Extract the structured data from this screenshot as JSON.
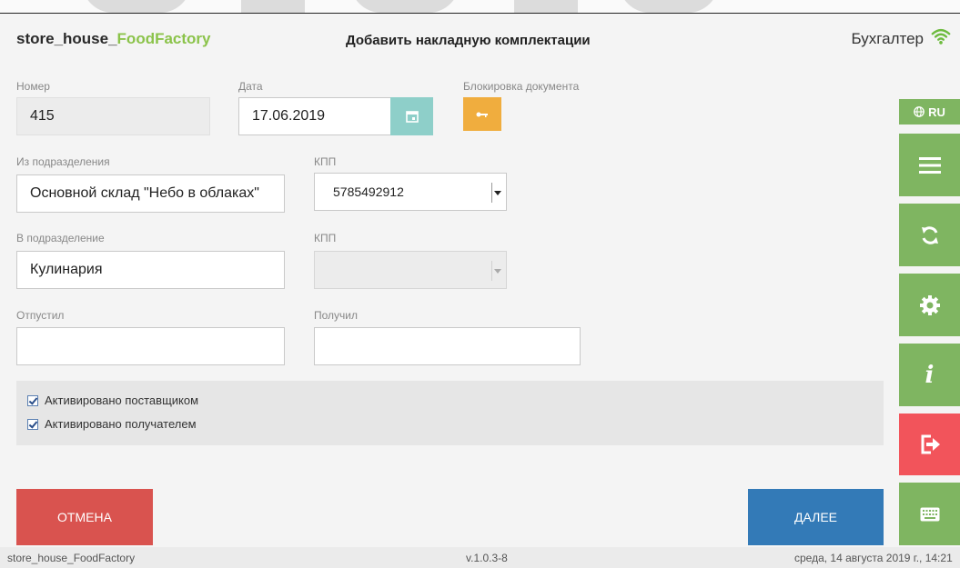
{
  "header": {
    "brand_main": "store_house_",
    "brand_accent": "FoodFactory",
    "title": "Добавить накладную комплектации",
    "user": "Бухгалтер"
  },
  "form": {
    "number_label": "Номер",
    "number_value": "415",
    "date_label": "Дата",
    "date_value": "17.06.2019",
    "lock_label": "Блокировка документа",
    "from_dept_label": "Из подразделения",
    "from_dept_value": "Основной склад \"Небо в облаках\"",
    "kpp1_label": "КПП",
    "kpp1_value": "5785492912",
    "to_dept_label": "В подразделение",
    "to_dept_value": "Кулинария",
    "kpp2_label": "КПП",
    "kpp2_value": "",
    "released_label": "Отпустил",
    "released_value": "",
    "received_label": "Получил",
    "received_value": ""
  },
  "checks": {
    "supplier_label": "Активировано поставщиком",
    "supplier_checked": true,
    "receiver_label": "Активировано получателем",
    "receiver_checked": true
  },
  "actions": {
    "cancel_label": "ОТМЕНА",
    "next_label": "ДАЛЕЕ"
  },
  "rail": {
    "lang_label": "RU",
    "icons": [
      "globe-icon",
      "menu-icon",
      "sync-icon",
      "gear-icon",
      "info-icon",
      "logout-icon",
      "keyboard-icon"
    ]
  },
  "footer": {
    "app": "store_house_FoodFactory",
    "version": "v.1.0.3-8",
    "datetime": "среда, 14 августа 2019 г., 14:21"
  },
  "colors": {
    "brand_accent": "#8bc34a",
    "rail_green": "#7fb561",
    "rail_red": "#f2545b",
    "cancel_red": "#d9534f",
    "next_blue": "#337ab7",
    "calendar_teal": "#8ecfc9",
    "lock_orange": "#f0ad3e"
  }
}
